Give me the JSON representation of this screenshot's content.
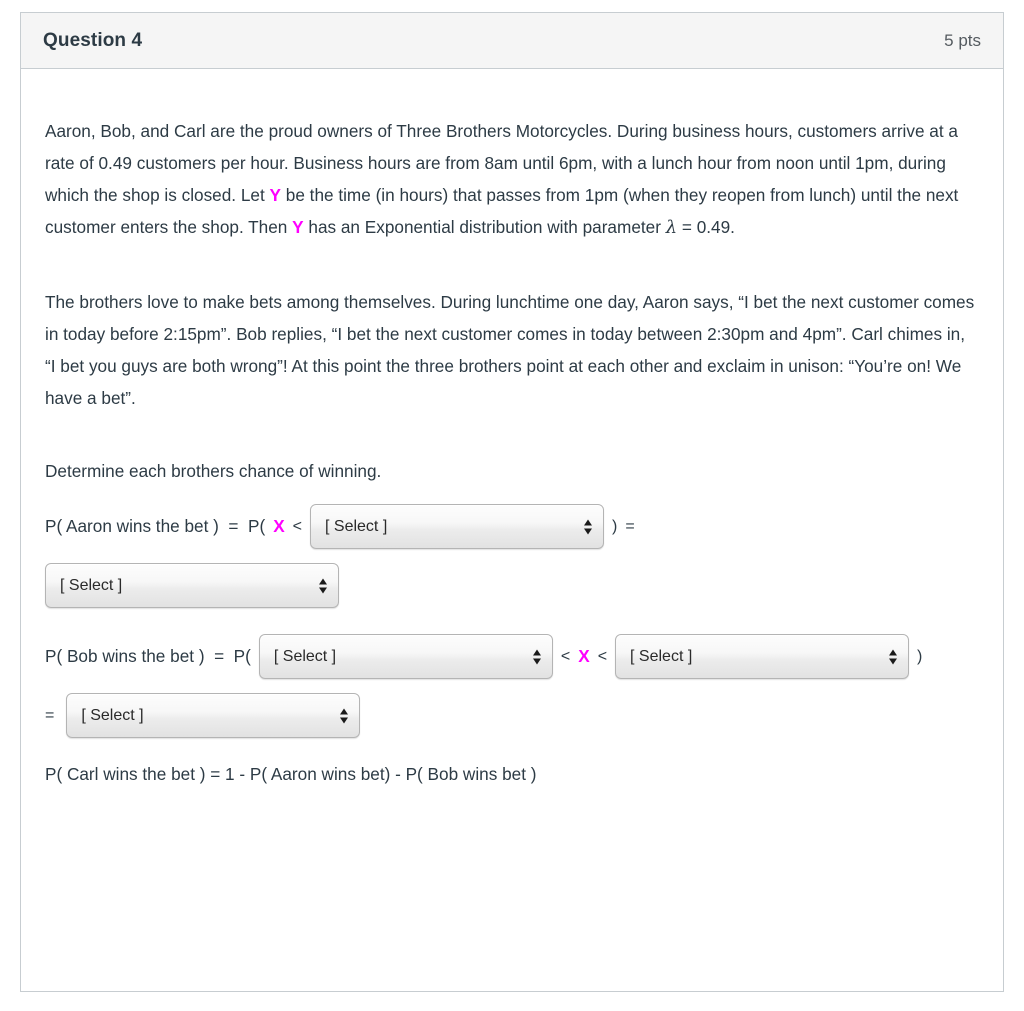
{
  "header": {
    "title": "Question 4",
    "points": "5 pts"
  },
  "paragraphs": {
    "p1_a": "Aaron, Bob, and Carl are the proud owners of Three Brothers Motorcycles.  During business hours, customers arrive at a rate of 0.49 customers per hour.  Business hours are from 8am until 6pm, with a lunch hour from noon until 1pm, during which the shop is closed.  Let ",
    "p1_var1": "Y",
    "p1_b": " be the time (in hours) that passes from 1pm (when they reopen from lunch) until the next customer enters the shop.  Then ",
    "p1_var2": "Y",
    "p1_c": " has an Exponential distribution with parameter ",
    "p1_lambda": "λ",
    "p1_d": " = 0.49.",
    "p2": "The brothers love to make bets among themselves.  During lunchtime one day, Aaron says, “I bet the next customer comes in today before 2:15pm”.  Bob replies, “I bet the next customer comes in today between 2:30pm and 4pm”.  Carl chimes in, “I bet you guys are both wrong”!  At this point the three brothers point at each other and exclaim in unison: “You’re on!  We have a bet”."
  },
  "prompt": "Determine each brothers chance of winning.",
  "aaron": {
    "label": "P( Aaron wins the bet )  =  P(",
    "variable": "X",
    "lt": "<",
    "close_paren": ")",
    "equals": "=",
    "select1": "[ Select ]",
    "select2": "[ Select ]"
  },
  "bob": {
    "label": "P( Bob wins the bet )  =  P(",
    "variable": "X",
    "lt_left": "<",
    "lt_right": "<",
    "close_paren": ")",
    "equals": "=",
    "select1": "[ Select ]",
    "select2": "[ Select ]",
    "select3": "[ Select ]"
  },
  "carl": {
    "line": "P( Carl wins the bet ) = 1 - P( Aaron wins bet) - P( Bob wins bet )"
  },
  "colors": {
    "variable_magenta": "#ff00ff",
    "text": "#2d3b45",
    "header_bg": "#f5f5f5",
    "border": "#c7cdd1"
  },
  "icons": {
    "select_arrows": "up-down-arrows-icon"
  }
}
